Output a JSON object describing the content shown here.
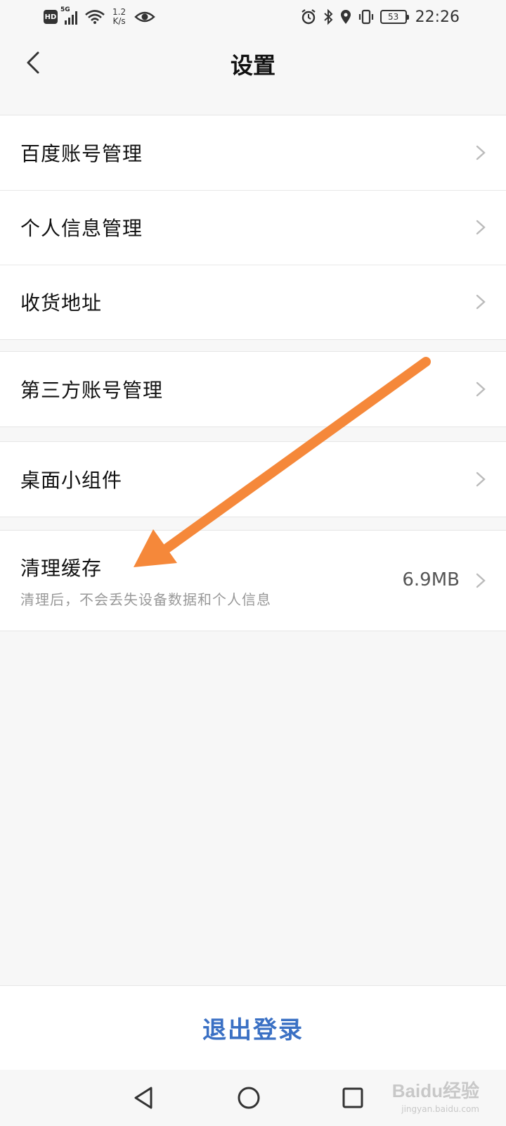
{
  "status_bar": {
    "hd": "HD",
    "signal_label": "5G",
    "net_speed_value": "1.2",
    "net_speed_unit": "K/s",
    "battery": "53",
    "time": "22:26"
  },
  "header": {
    "title": "设置"
  },
  "groups": [
    {
      "items": [
        {
          "label": "百度账号管理"
        },
        {
          "label": "个人信息管理"
        },
        {
          "label": "收货地址"
        }
      ]
    },
    {
      "items": [
        {
          "label": "第三方账号管理"
        }
      ]
    },
    {
      "items": [
        {
          "label": "桌面小组件"
        }
      ]
    },
    {
      "items": [
        {
          "label": "清理缓存",
          "subtitle": "清理后，不会丢失设备数据和个人信息",
          "value": "6.9MB"
        }
      ]
    }
  ],
  "logout": {
    "label": "退出登录"
  },
  "watermark": {
    "main": "Baidu经验",
    "sub": "jingyan.baidu.com"
  },
  "annotation": {
    "arrow_color": "#f5883a"
  }
}
